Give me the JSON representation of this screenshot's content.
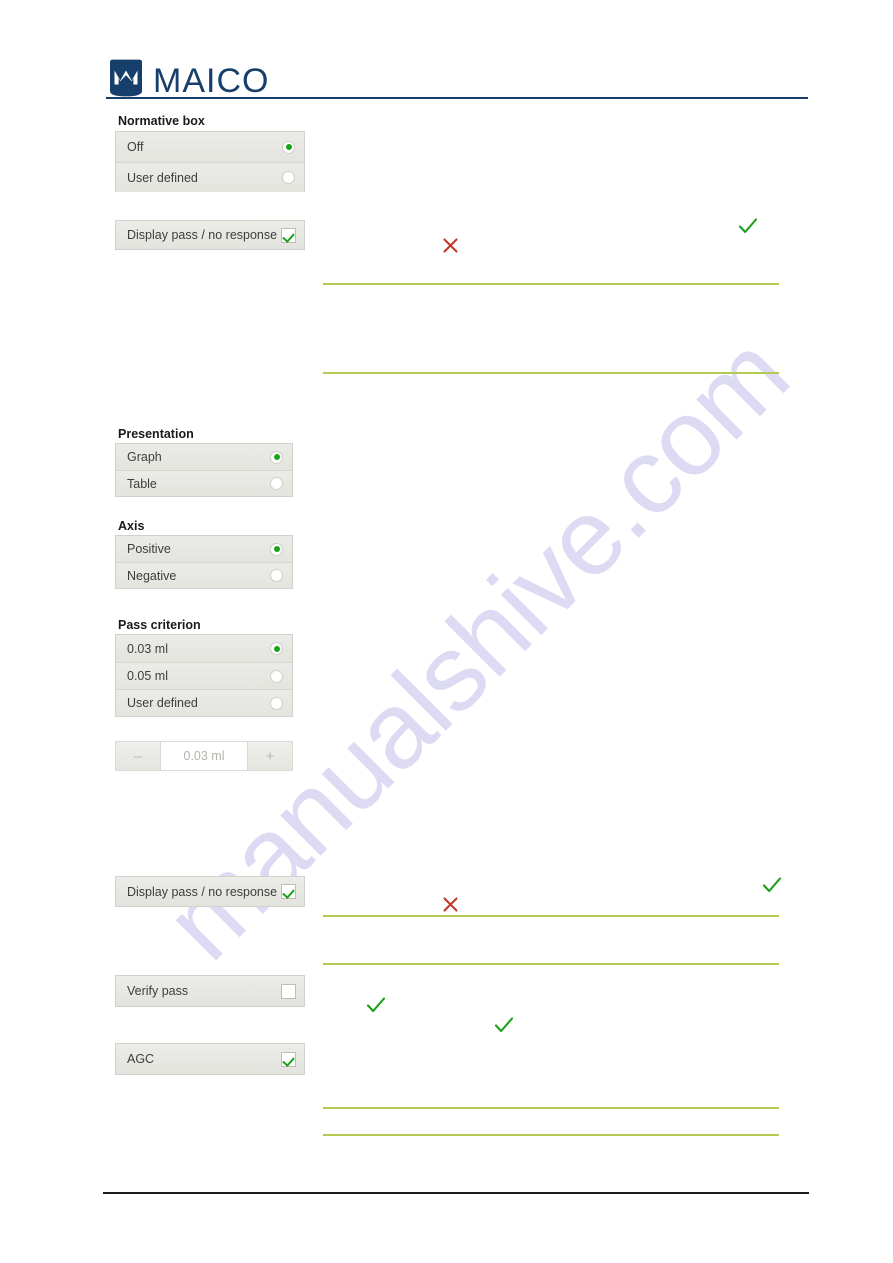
{
  "header": {
    "logo_text": "MAICO",
    "logo_icon": "maico-wave-logo-icon",
    "brand_color": "#173f6b"
  },
  "watermark": {
    "text": "manualshive.com",
    "color": "#c9c6ee"
  },
  "theme": {
    "rule_green": "#b0ca52",
    "check_green": "#1aa01a",
    "cross_red": "#c0392b",
    "panel_bg": "#e6e6e1"
  },
  "panels": {
    "normative_box": {
      "title": "Normative box",
      "options": [
        {
          "label": "Off",
          "selected": true
        },
        {
          "label": "User defined",
          "selected": false
        }
      ]
    },
    "display_pass_top": {
      "label": "Display pass / no response",
      "checked": true
    },
    "presentation": {
      "title": "Presentation",
      "options": [
        {
          "label": "Graph",
          "selected": true
        },
        {
          "label": "Table",
          "selected": false
        }
      ]
    },
    "axis": {
      "title": "Axis",
      "options": [
        {
          "label": "Positive",
          "selected": true
        },
        {
          "label": "Negative",
          "selected": false
        }
      ]
    },
    "pass_criterion": {
      "title": "Pass criterion",
      "options": [
        {
          "label": "0.03 ml",
          "selected": true
        },
        {
          "label": "0.05 ml",
          "selected": false
        },
        {
          "label": "User defined",
          "selected": false
        }
      ]
    },
    "pass_criterion_stepper": {
      "decrement_label": "–",
      "value": "0.03 ml",
      "increment_label": "+"
    },
    "display_pass_bottom": {
      "label": "Display pass / no response",
      "checked": true
    },
    "verify_pass": {
      "label": "Verify pass",
      "checked": false
    },
    "agc": {
      "label": "AGC",
      "checked": true
    }
  },
  "marks": [
    {
      "name": "cross-mark-1",
      "type": "cross"
    },
    {
      "name": "check-mark-1",
      "type": "check"
    },
    {
      "name": "cross-mark-2",
      "type": "cross"
    },
    {
      "name": "check-mark-2",
      "type": "check"
    },
    {
      "name": "check-mark-3",
      "type": "check"
    },
    {
      "name": "check-mark-4",
      "type": "check"
    }
  ],
  "rules": {
    "green_rule_count": 6,
    "header_rule": true,
    "footer_rule": true
  }
}
